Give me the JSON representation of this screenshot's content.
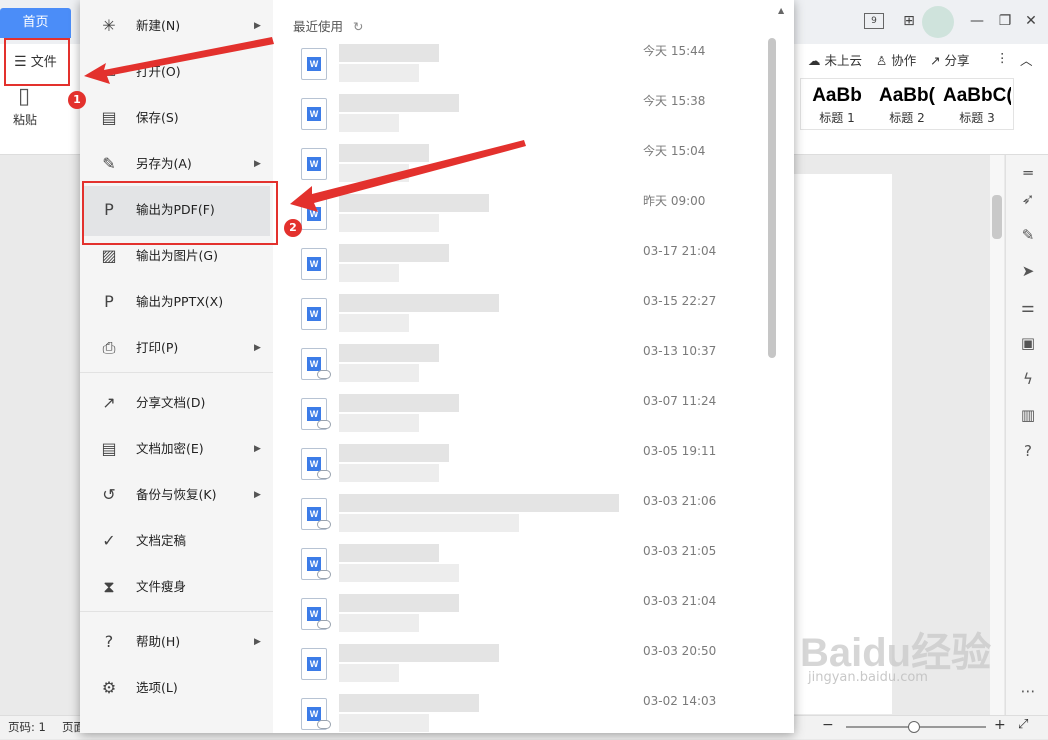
{
  "titlebar": {
    "home_tab": "首页",
    "page_indicator_icon": "page-counter-icon",
    "grid_icon": "apps-grid-icon",
    "minimize": "—",
    "restore": "❐",
    "close": "✕"
  },
  "ribbon": {
    "file_button": "文件",
    "paste_label": "粘贴",
    "cloud_label": "未上云",
    "collab_label": "协作",
    "share_label": "分享",
    "styles": [
      {
        "sample": "AaBb",
        "label": "标题 1"
      },
      {
        "sample": "AaBb(",
        "label": "标题 2"
      },
      {
        "sample": "AaBbC(",
        "label": "标题 3"
      }
    ]
  },
  "menu": {
    "items": [
      {
        "label": "新建(N)",
        "icon": "new-doc-icon",
        "glyph": "✳",
        "arrow": true
      },
      {
        "label": "打开(O)",
        "icon": "folder-open-icon",
        "glyph": "▭",
        "arrow": false
      },
      {
        "label": "保存(S)",
        "icon": "save-icon",
        "glyph": "▤",
        "arrow": false
      },
      {
        "label": "另存为(A)",
        "icon": "save-as-icon",
        "glyph": "✎",
        "arrow": true
      },
      {
        "label": "输出为PDF(F)",
        "icon": "export-pdf-icon",
        "glyph": "P",
        "arrow": false
      },
      {
        "label": "输出为图片(G)",
        "icon": "export-image-icon",
        "glyph": "▨",
        "arrow": false
      },
      {
        "label": "输出为PPTX(X)",
        "icon": "export-pptx-icon",
        "glyph": "P",
        "arrow": false
      },
      {
        "label": "打印(P)",
        "icon": "print-icon",
        "glyph": "⎙",
        "arrow": true
      },
      {
        "label": "分享文档(D)",
        "icon": "share-doc-icon",
        "glyph": "↗",
        "arrow": false
      },
      {
        "label": "文档加密(E)",
        "icon": "encrypt-icon",
        "glyph": "▤",
        "arrow": true
      },
      {
        "label": "备份与恢复(K)",
        "icon": "backup-icon",
        "glyph": "↺",
        "arrow": true
      },
      {
        "label": "文档定稿",
        "icon": "finalize-icon",
        "glyph": "✓",
        "arrow": false
      },
      {
        "label": "文件瘦身",
        "icon": "slim-file-icon",
        "glyph": "⧗",
        "arrow": false
      },
      {
        "label": "帮助(H)",
        "icon": "help-icon",
        "glyph": "?",
        "arrow": true
      },
      {
        "label": "选项(L)",
        "icon": "options-gear-icon",
        "glyph": "⚙",
        "arrow": false
      }
    ]
  },
  "recent": {
    "title": "最近使用",
    "items": [
      {
        "time": "今天  15:44",
        "cloud": false
      },
      {
        "time": "今天  15:38",
        "cloud": false
      },
      {
        "time": "今天  15:04",
        "cloud": false
      },
      {
        "time": "昨天  09:00",
        "cloud": false
      },
      {
        "time": "03-17 21:04",
        "cloud": false
      },
      {
        "time": "03-15 22:27",
        "cloud": false
      },
      {
        "time": "03-13 10:37",
        "cloud": true
      },
      {
        "time": "03-07 11:24",
        "cloud": true
      },
      {
        "time": "03-05 19:11",
        "cloud": true
      },
      {
        "time": "03-03 21:06",
        "cloud": true
      },
      {
        "time": "03-03 21:05",
        "cloud": true
      },
      {
        "time": "03-03 21:04",
        "cloud": true
      },
      {
        "time": "03-03 20:50",
        "cloud": false
      },
      {
        "time": "03-02 14:03",
        "cloud": true
      }
    ]
  },
  "status": {
    "page_label": "页码: 1",
    "page_short": "页面"
  },
  "annotations": {
    "badge1": "1",
    "badge2": "2"
  },
  "watermark": {
    "brand": "Baidu经验",
    "url": "jingyan.baidu.com"
  }
}
